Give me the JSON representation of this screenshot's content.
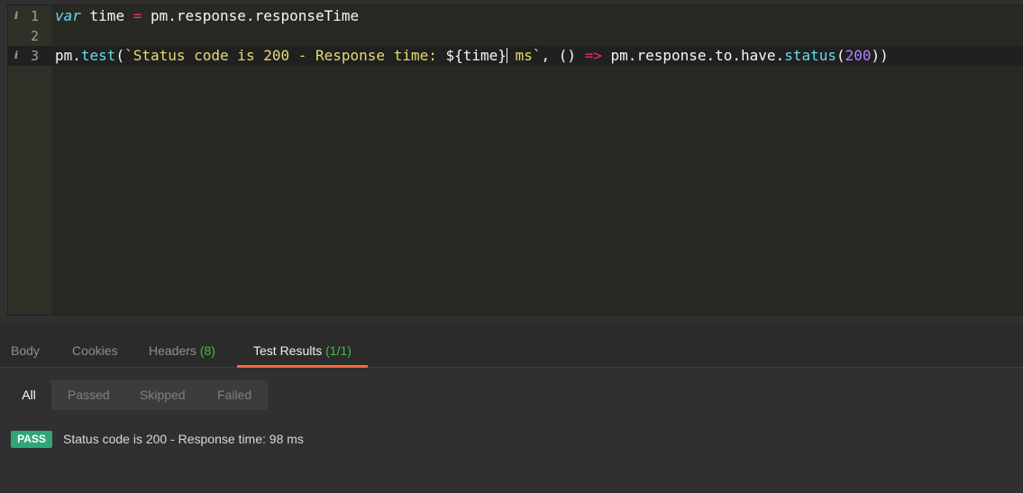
{
  "editor": {
    "lines": [
      {
        "number": "1",
        "has_info": true
      },
      {
        "number": "2",
        "has_info": false
      },
      {
        "number": "3",
        "has_info": true
      }
    ],
    "line1": {
      "kw": "var",
      "ident": " time ",
      "op": "=",
      "rest": " pm.response.responseTime"
    },
    "line3": {
      "obj": "pm.",
      "fn": "test",
      "paren_open": "(",
      "string_a": "`Status code is 200 - Response time: ",
      "interp": "${time}",
      "string_b": " ms`",
      "comma": ", () ",
      "arrow": "=>",
      "chain": " pm.response.to.have.",
      "fn2": "status",
      "paren2_open": "(",
      "num": "200",
      "close": "))"
    },
    "info_glyph": "i"
  },
  "response_tabs": {
    "body": "Body",
    "cookies": "Cookies",
    "headers": "Headers",
    "headers_count": "(8)",
    "test_results": "Test Results",
    "test_results_count": "(1/1)"
  },
  "filters": {
    "all": "All",
    "passed": "Passed",
    "skipped": "Skipped",
    "failed": "Failed"
  },
  "results": [
    {
      "status": "PASS",
      "text": "Status code is 200 - Response time: 98 ms"
    }
  ],
  "colors": {
    "pass": "#2ea776",
    "active_tab_underline": "#f26b3a",
    "count_green": "#48b94f"
  }
}
